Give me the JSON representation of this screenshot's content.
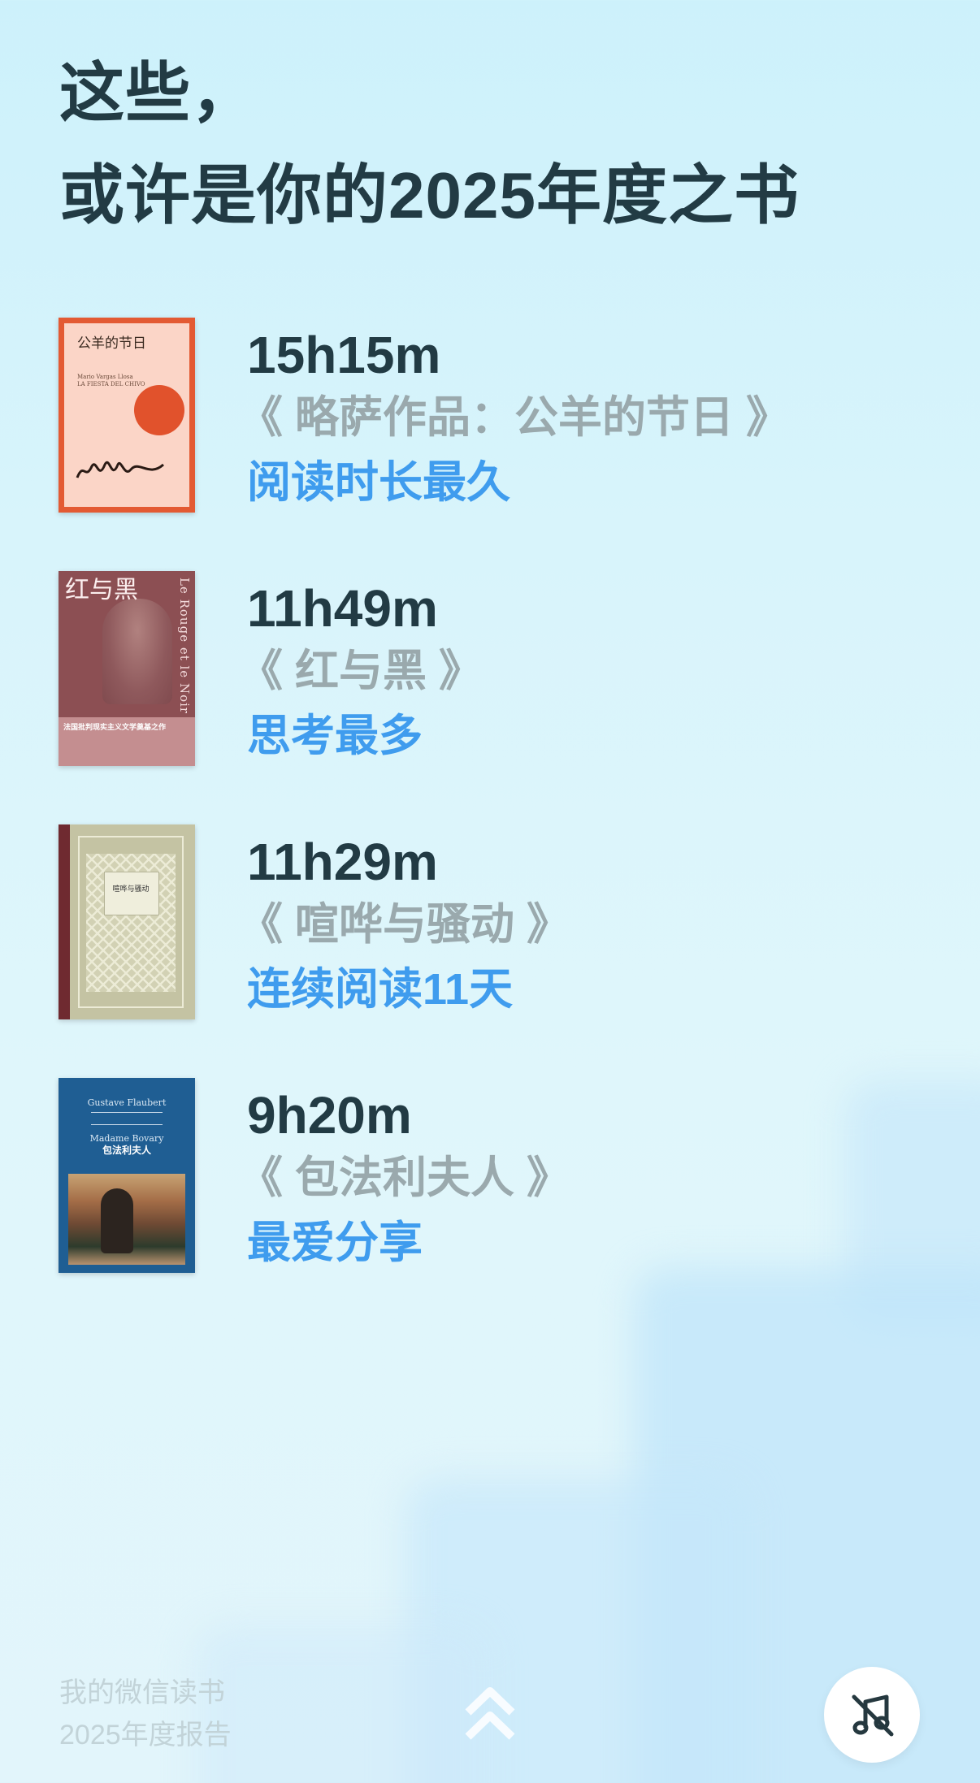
{
  "header": {
    "title_line1": "这些，",
    "title_line2": "或许是你的2025年度之书"
  },
  "books": [
    {
      "duration": "15h15m",
      "title": "《 略萨作品：公羊的节日 》",
      "tag": "阅读时长最久",
      "cover": {
        "title": "公羊的节日",
        "author_latin": "Mario Vargas Llosa",
        "subtitle": "LA FIESTA DEL CHIVO",
        "accent": "#e35a33"
      }
    },
    {
      "duration": "11h49m",
      "title": "《 红与黑 》",
      "tag": "思考最多",
      "cover": {
        "title": "红与黑",
        "title_latin": "Le Rouge et le Noir",
        "band_text": "法国批判现实主义文学奠基之作",
        "accent": "#8c4f53"
      }
    },
    {
      "duration": "11h29m",
      "title": "《 喧哗与骚动 》",
      "tag": "连续阅读11天",
      "cover": {
        "title": "喧哗与骚动",
        "accent": "#c4c3a3"
      }
    },
    {
      "duration": "9h20m",
      "title": "《 包法利夫人 》",
      "tag": "最爱分享",
      "cover": {
        "author_latin": "Gustave Flaubert",
        "title_latin": "Madame Bovary",
        "title": "包法利夫人",
        "accent": "#1f5e93"
      }
    }
  ],
  "footer": {
    "line1": "我的微信读书",
    "line2": "2025年度报告"
  },
  "controls": {
    "scroll_up_icon": "chevron-up-icon",
    "music_icon": "music-off-icon"
  },
  "colors": {
    "title": "#223b44",
    "book_title": "#9aa9ad",
    "tag": "#3f9cee",
    "footer": "#c2d3d8"
  }
}
